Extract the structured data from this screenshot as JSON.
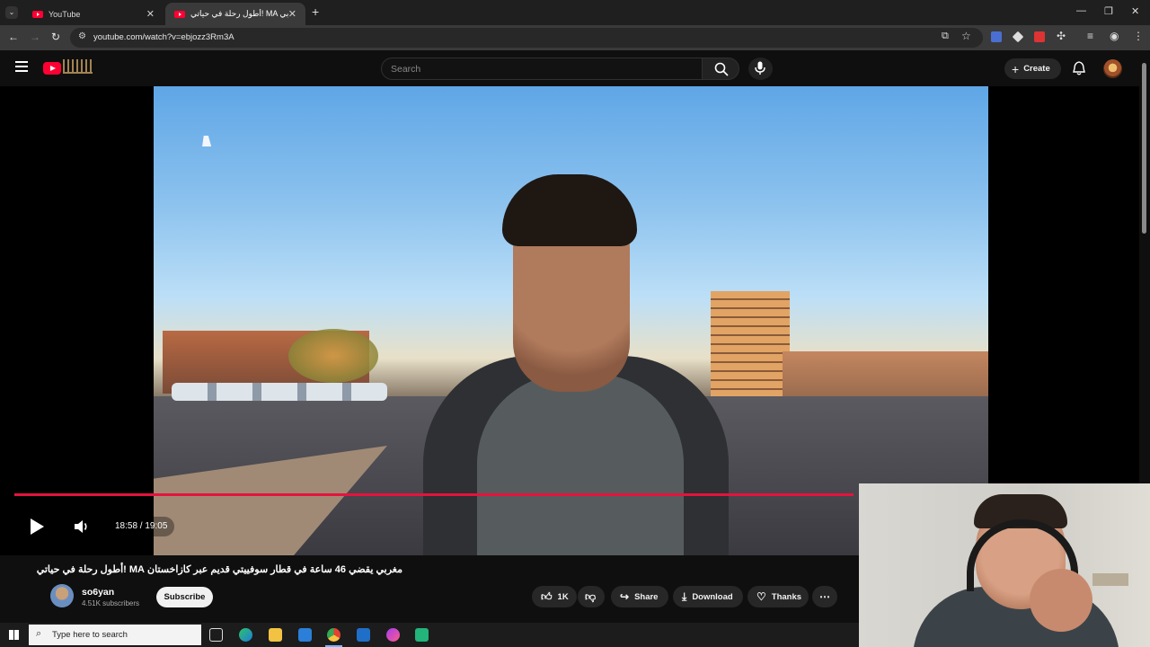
{
  "browser": {
    "tabs": [
      {
        "label": "YouTube",
        "active": false
      },
      {
        "label": "أطول رحلة في حياتي! MA مغربي",
        "active": true
      }
    ],
    "new_tab_icon": "plus-icon",
    "url": "youtube.com/watch?v=ebjozz3Rm3A",
    "window_controls": [
      "minimize-icon",
      "restore-icon",
      "close-icon"
    ]
  },
  "youtube": {
    "search_placeholder": "Search",
    "create_label": "Create",
    "icons": [
      "menu-icon",
      "youtube-logo",
      "search-icon",
      "mic-icon",
      "bell-icon",
      "avatar"
    ]
  },
  "player": {
    "time_display": "18:58 / 19:05",
    "progress_fraction": 0.994,
    "icons": [
      "play-icon",
      "volume-icon"
    ]
  },
  "video": {
    "title": "مغربي يقضي 46 ساعة في قطار سوفييتي قديم عبر كازاخستان MA !أطول رحلة في حياتي",
    "channel_name": "so6yan",
    "subscribers": "4.51K subscribers",
    "subscribe_label": "Subscribe",
    "like_count": "1K",
    "share_label": "Share",
    "download_label": "Download",
    "thanks_label": "Thanks"
  },
  "taskbar": {
    "search_placeholder": "Type here to search"
  },
  "colors": {
    "accent": "#ff0033",
    "progress": "#e5133d",
    "background": "#0f0f0f"
  }
}
